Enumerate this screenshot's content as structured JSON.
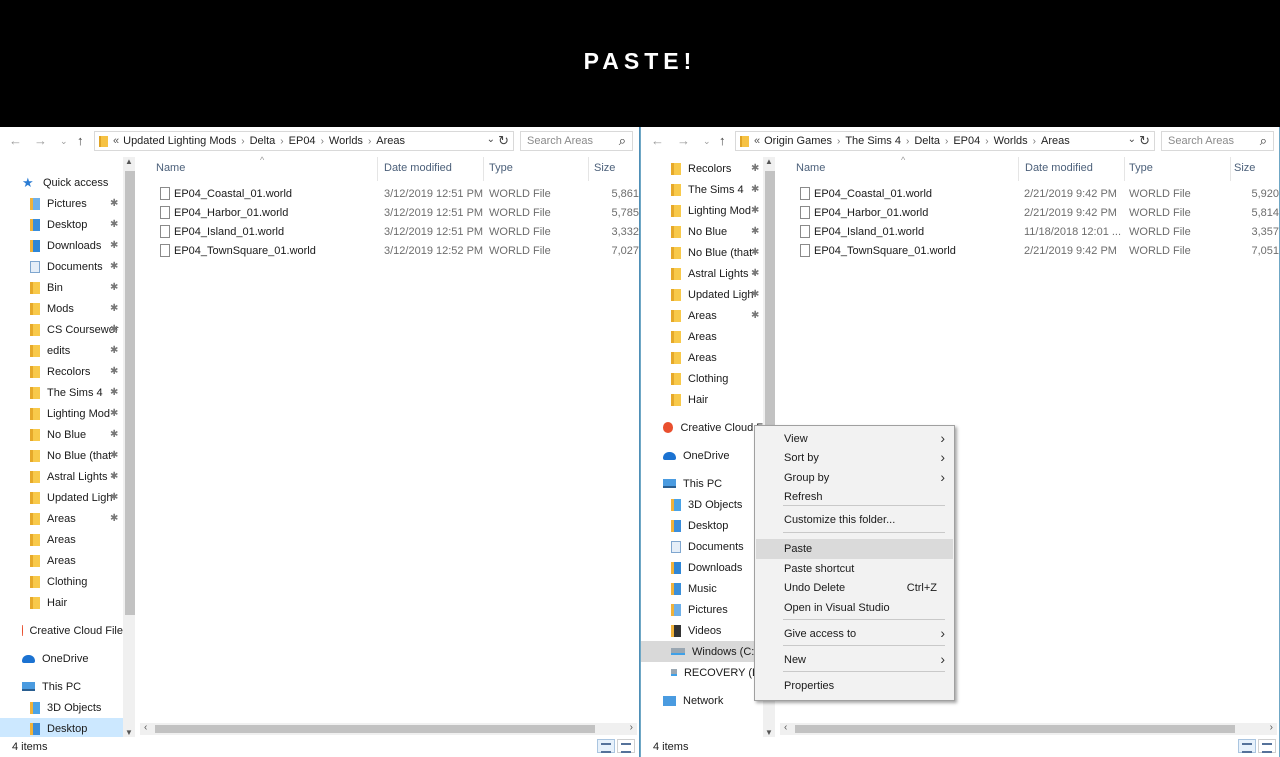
{
  "banner": {
    "title": "PASTE!"
  },
  "left": {
    "breadcrumb": [
      "Updated Lighting Mods",
      "Delta",
      "EP04",
      "Worlds",
      "Areas"
    ],
    "search_placeholder": "Search Areas",
    "nav": [
      {
        "label": "Quick access",
        "icon": "star-icon"
      },
      {
        "label": "Pictures",
        "icon": "pictures-icon"
      },
      {
        "label": "Desktop",
        "icon": "desktop-icon"
      },
      {
        "label": "Downloads",
        "icon": "downloads-icon"
      },
      {
        "label": "Documents",
        "icon": "documents-icon"
      },
      {
        "label": "Bin",
        "icon": "folder-icon"
      },
      {
        "label": "Mods",
        "icon": "folder-icon"
      },
      {
        "label": "CS Coursewor",
        "icon": "folder-icon"
      },
      {
        "label": "edits",
        "icon": "folder-icon"
      },
      {
        "label": "Recolors",
        "icon": "folder-icon"
      },
      {
        "label": "The Sims 4",
        "icon": "folder-icon"
      },
      {
        "label": "Lighting Mod",
        "icon": "folder-icon"
      },
      {
        "label": "No Blue",
        "icon": "folder-icon"
      },
      {
        "label": "No Blue (that",
        "icon": "folder-icon"
      },
      {
        "label": "Astral Lights -",
        "icon": "folder-icon"
      },
      {
        "label": "Updated Ligh",
        "icon": "folder-icon"
      },
      {
        "label": "Areas",
        "icon": "folder-icon"
      },
      {
        "label": "Areas",
        "icon": "folder-icon"
      },
      {
        "label": "Areas",
        "icon": "folder-icon"
      },
      {
        "label": "Clothing",
        "icon": "folder-icon"
      },
      {
        "label": "Hair",
        "icon": "folder-icon"
      },
      {
        "label": "Creative Cloud File",
        "icon": "creative-cloud-icon"
      },
      {
        "label": "OneDrive",
        "icon": "onedrive-icon"
      },
      {
        "label": "This PC",
        "icon": "this-pc-icon"
      },
      {
        "label": "3D Objects",
        "icon": "3d-objects-icon"
      },
      {
        "label": "Desktop",
        "icon": "desktop-icon"
      }
    ],
    "columns": {
      "name": "Name",
      "date": "Date modified",
      "type": "Type",
      "size": "Size"
    },
    "files": [
      {
        "name": "EP04_Coastal_01.world",
        "date": "3/12/2019 12:51 PM",
        "type": "WORLD File",
        "size": "5,861"
      },
      {
        "name": "EP04_Harbor_01.world",
        "date": "3/12/2019 12:51 PM",
        "type": "WORLD File",
        "size": "5,785"
      },
      {
        "name": "EP04_Island_01.world",
        "date": "3/12/2019 12:51 PM",
        "type": "WORLD File",
        "size": "3,332"
      },
      {
        "name": "EP04_TownSquare_01.world",
        "date": "3/12/2019 12:52 PM",
        "type": "WORLD File",
        "size": "7,027"
      }
    ],
    "status": "4 items"
  },
  "right": {
    "breadcrumb": [
      "Origin Games",
      "The Sims 4",
      "Delta",
      "EP04",
      "Worlds",
      "Areas"
    ],
    "search_placeholder": "Search Areas",
    "nav": [
      {
        "label": "Recolors",
        "icon": "folder-icon"
      },
      {
        "label": "The Sims 4",
        "icon": "folder-icon"
      },
      {
        "label": "Lighting Mod",
        "icon": "folder-icon"
      },
      {
        "label": "No Blue",
        "icon": "folder-icon"
      },
      {
        "label": "No Blue (that",
        "icon": "folder-icon"
      },
      {
        "label": "Astral Lights -",
        "icon": "folder-icon"
      },
      {
        "label": "Updated Ligh",
        "icon": "folder-icon"
      },
      {
        "label": "Areas",
        "icon": "folder-icon"
      },
      {
        "label": "Areas",
        "icon": "folder-icon"
      },
      {
        "label": "Areas",
        "icon": "folder-icon"
      },
      {
        "label": "Clothing",
        "icon": "folder-icon"
      },
      {
        "label": "Hair",
        "icon": "folder-icon"
      },
      {
        "label": "Creative Cloud F",
        "icon": "creative-cloud-icon"
      },
      {
        "label": "OneDrive",
        "icon": "onedrive-icon"
      },
      {
        "label": "This PC",
        "icon": "this-pc-icon"
      },
      {
        "label": "3D Objects",
        "icon": "3d-objects-icon"
      },
      {
        "label": "Desktop",
        "icon": "desktop-icon"
      },
      {
        "label": "Documents",
        "icon": "documents-icon"
      },
      {
        "label": "Downloads",
        "icon": "downloads-icon"
      },
      {
        "label": "Music",
        "icon": "music-icon"
      },
      {
        "label": "Pictures",
        "icon": "pictures-icon"
      },
      {
        "label": "Videos",
        "icon": "videos-icon"
      },
      {
        "label": "Windows (C:)",
        "icon": "drive-icon"
      },
      {
        "label": "RECOVERY (D:",
        "icon": "drive-icon"
      },
      {
        "label": "Network",
        "icon": "network-icon"
      }
    ],
    "columns": {
      "name": "Name",
      "date": "Date modified",
      "type": "Type",
      "size": "Size"
    },
    "files": [
      {
        "name": "EP04_Coastal_01.world",
        "date": "2/21/2019 9:42 PM",
        "type": "WORLD File",
        "size": "5,920"
      },
      {
        "name": "EP04_Harbor_01.world",
        "date": "2/21/2019 9:42 PM",
        "type": "WORLD File",
        "size": "5,814"
      },
      {
        "name": "EP04_Island_01.world",
        "date": "11/18/2018 12:01 ...",
        "type": "WORLD File",
        "size": "3,357"
      },
      {
        "name": "EP04_TownSquare_01.world",
        "date": "2/21/2019 9:42 PM",
        "type": "WORLD File",
        "size": "7,051"
      }
    ],
    "status": "4 items"
  },
  "context_menu": {
    "items": [
      {
        "label": "View",
        "submenu": true
      },
      {
        "label": "Sort by",
        "submenu": true
      },
      {
        "label": "Group by",
        "submenu": true
      },
      {
        "label": "Refresh"
      },
      {
        "label": "Customize this folder..."
      },
      {
        "label": "Paste",
        "highlighted": true
      },
      {
        "label": "Paste shortcut"
      },
      {
        "label": "Undo Delete",
        "shortcut": "Ctrl+Z"
      },
      {
        "label": "Open in Visual Studio"
      },
      {
        "label": "Give access to",
        "submenu": true
      },
      {
        "label": "New",
        "submenu": true
      },
      {
        "label": "Properties"
      }
    ]
  },
  "colors": {
    "banner_bg": "#000000",
    "selection": "#cce8ff",
    "menu_highlight": "#dadada",
    "folder": "#f8c94a",
    "accent": "#2b7cd3"
  }
}
